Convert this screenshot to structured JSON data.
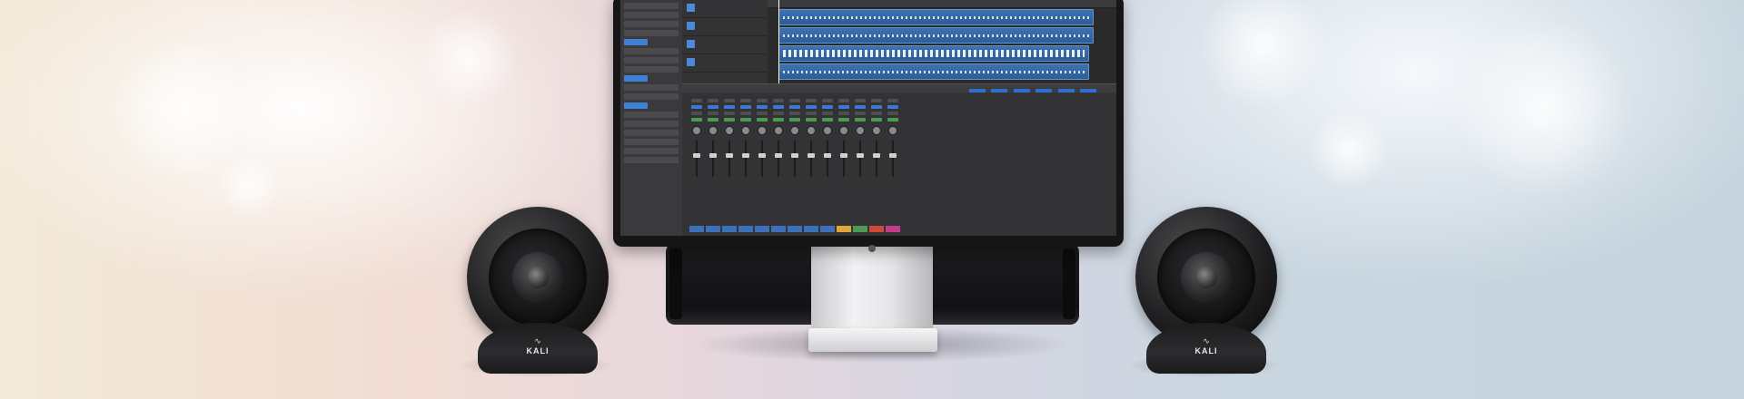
{
  "speaker_left": {
    "brand": "KALI"
  },
  "speaker_right": {
    "brand": "KALI"
  }
}
